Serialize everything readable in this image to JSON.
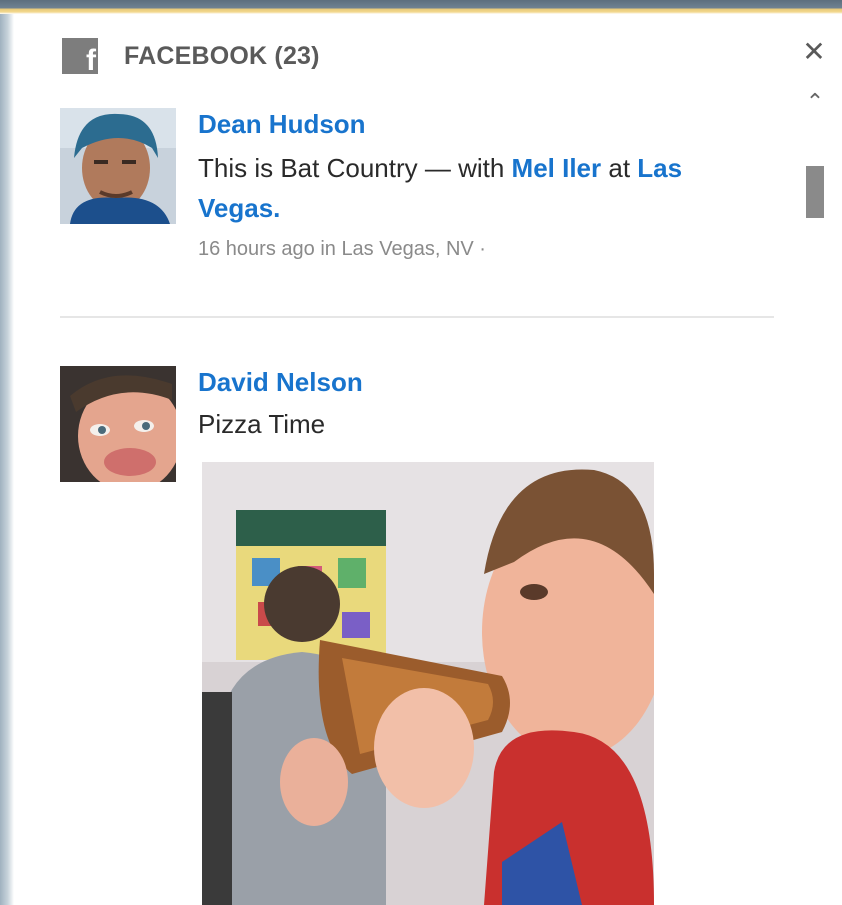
{
  "header": {
    "title": "FACEBOOK (23)",
    "icon": "facebook-icon"
  },
  "controls": {
    "close": "✕",
    "scroll_up": "⌃"
  },
  "posts": [
    {
      "author": "Dean Hudson",
      "text_before": "This is Bat Country — with ",
      "mention": "Mel Iler",
      "text_mid": " at ",
      "place": "Las Vegas",
      "text_end": ".",
      "meta": "16 hours ago in Las Vegas, NV ·"
    },
    {
      "author": "David Nelson",
      "text": "Pizza Time"
    }
  ],
  "colors": {
    "link": "#1874cd",
    "header_text": "#5a5a5a",
    "meta": "#8a8a8a"
  }
}
